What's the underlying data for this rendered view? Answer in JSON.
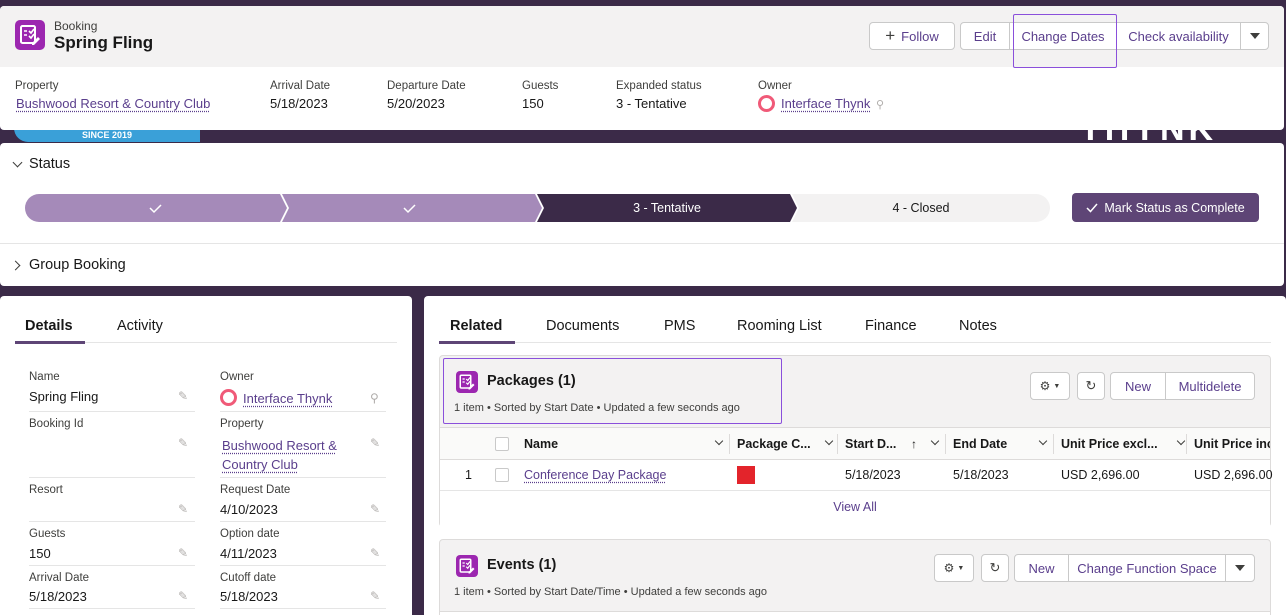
{
  "header": {
    "eyebrow": "Booking",
    "title": "Spring Fling",
    "buttons": {
      "follow": "Follow",
      "edit": "Edit",
      "change_dates": "Change Dates",
      "check_availability": "Check availability"
    },
    "fields": [
      {
        "label": "Property",
        "value": "Bushwood Resort & Country Club"
      },
      {
        "label": "Arrival Date",
        "value": "5/18/2023"
      },
      {
        "label": "Departure Date",
        "value": "5/20/2023"
      },
      {
        "label": "Guests",
        "value": "150"
      },
      {
        "label": "Expanded status",
        "value": "3 - Tentative"
      },
      {
        "label": "Owner",
        "value": "Interface Thynk"
      }
    ]
  },
  "background": {
    "since": "SINCE 2019"
  },
  "status": {
    "section_title": "Status",
    "steps": [
      {
        "label": "",
        "state": "complete"
      },
      {
        "label": "",
        "state": "complete"
      },
      {
        "label": "3 - Tentative",
        "state": "current"
      },
      {
        "label": "4 - Closed",
        "state": "incomplete"
      }
    ],
    "mark_button": "Mark Status as Complete",
    "group_booking": "Group Booking"
  },
  "details": {
    "tabs": [
      "Details",
      "Activity"
    ],
    "left": [
      {
        "label": "Name",
        "value": "Spring Fling"
      },
      {
        "label": "Booking Id",
        "value": ""
      },
      {
        "label": "Resort",
        "value": ""
      },
      {
        "label": "Guests",
        "value": "150"
      },
      {
        "label": "Arrival Date",
        "value": "5/18/2023"
      }
    ],
    "right": [
      {
        "label": "Owner",
        "value": "Interface Thynk"
      },
      {
        "label": "Property",
        "value_line1": "Bushwood Resort &",
        "value_line2": "Country Club"
      },
      {
        "label": "Request Date",
        "value": "4/10/2023"
      },
      {
        "label": "Option date",
        "value": "4/11/2023"
      },
      {
        "label": "Cutoff date",
        "value": "5/18/2023"
      }
    ]
  },
  "related": {
    "tabs": [
      "Related",
      "Documents",
      "PMS",
      "Rooming List",
      "Finance",
      "Notes"
    ],
    "packages": {
      "title": "Packages (1)",
      "subtitle": "1 item • Sorted by Start Date • Updated a few seconds ago",
      "new": "New",
      "multidelete": "Multidelete",
      "columns": [
        "Name",
        "Package C...",
        "Start D...",
        "End Date",
        "Unit Price excl...",
        "Unit Price inc"
      ],
      "rows": [
        {
          "num": "1",
          "name": "Conference Day Package",
          "color": "#e3242b",
          "start": "5/18/2023",
          "end": "5/18/2023",
          "price_excl": "USD 2,696.00",
          "price_incl": "USD 2,696.00"
        }
      ],
      "view_all": "View All"
    },
    "events": {
      "title": "Events (1)",
      "subtitle": "1 item • Sorted by Start Date/Time • Updated a few seconds ago",
      "new": "New",
      "change_function_space": "Change Function Space"
    }
  },
  "colors": {
    "accent": "#5a3e8c",
    "path_complete": "#a58ab9",
    "path_current": "#3b2a48",
    "icon": "#9c27b0"
  }
}
